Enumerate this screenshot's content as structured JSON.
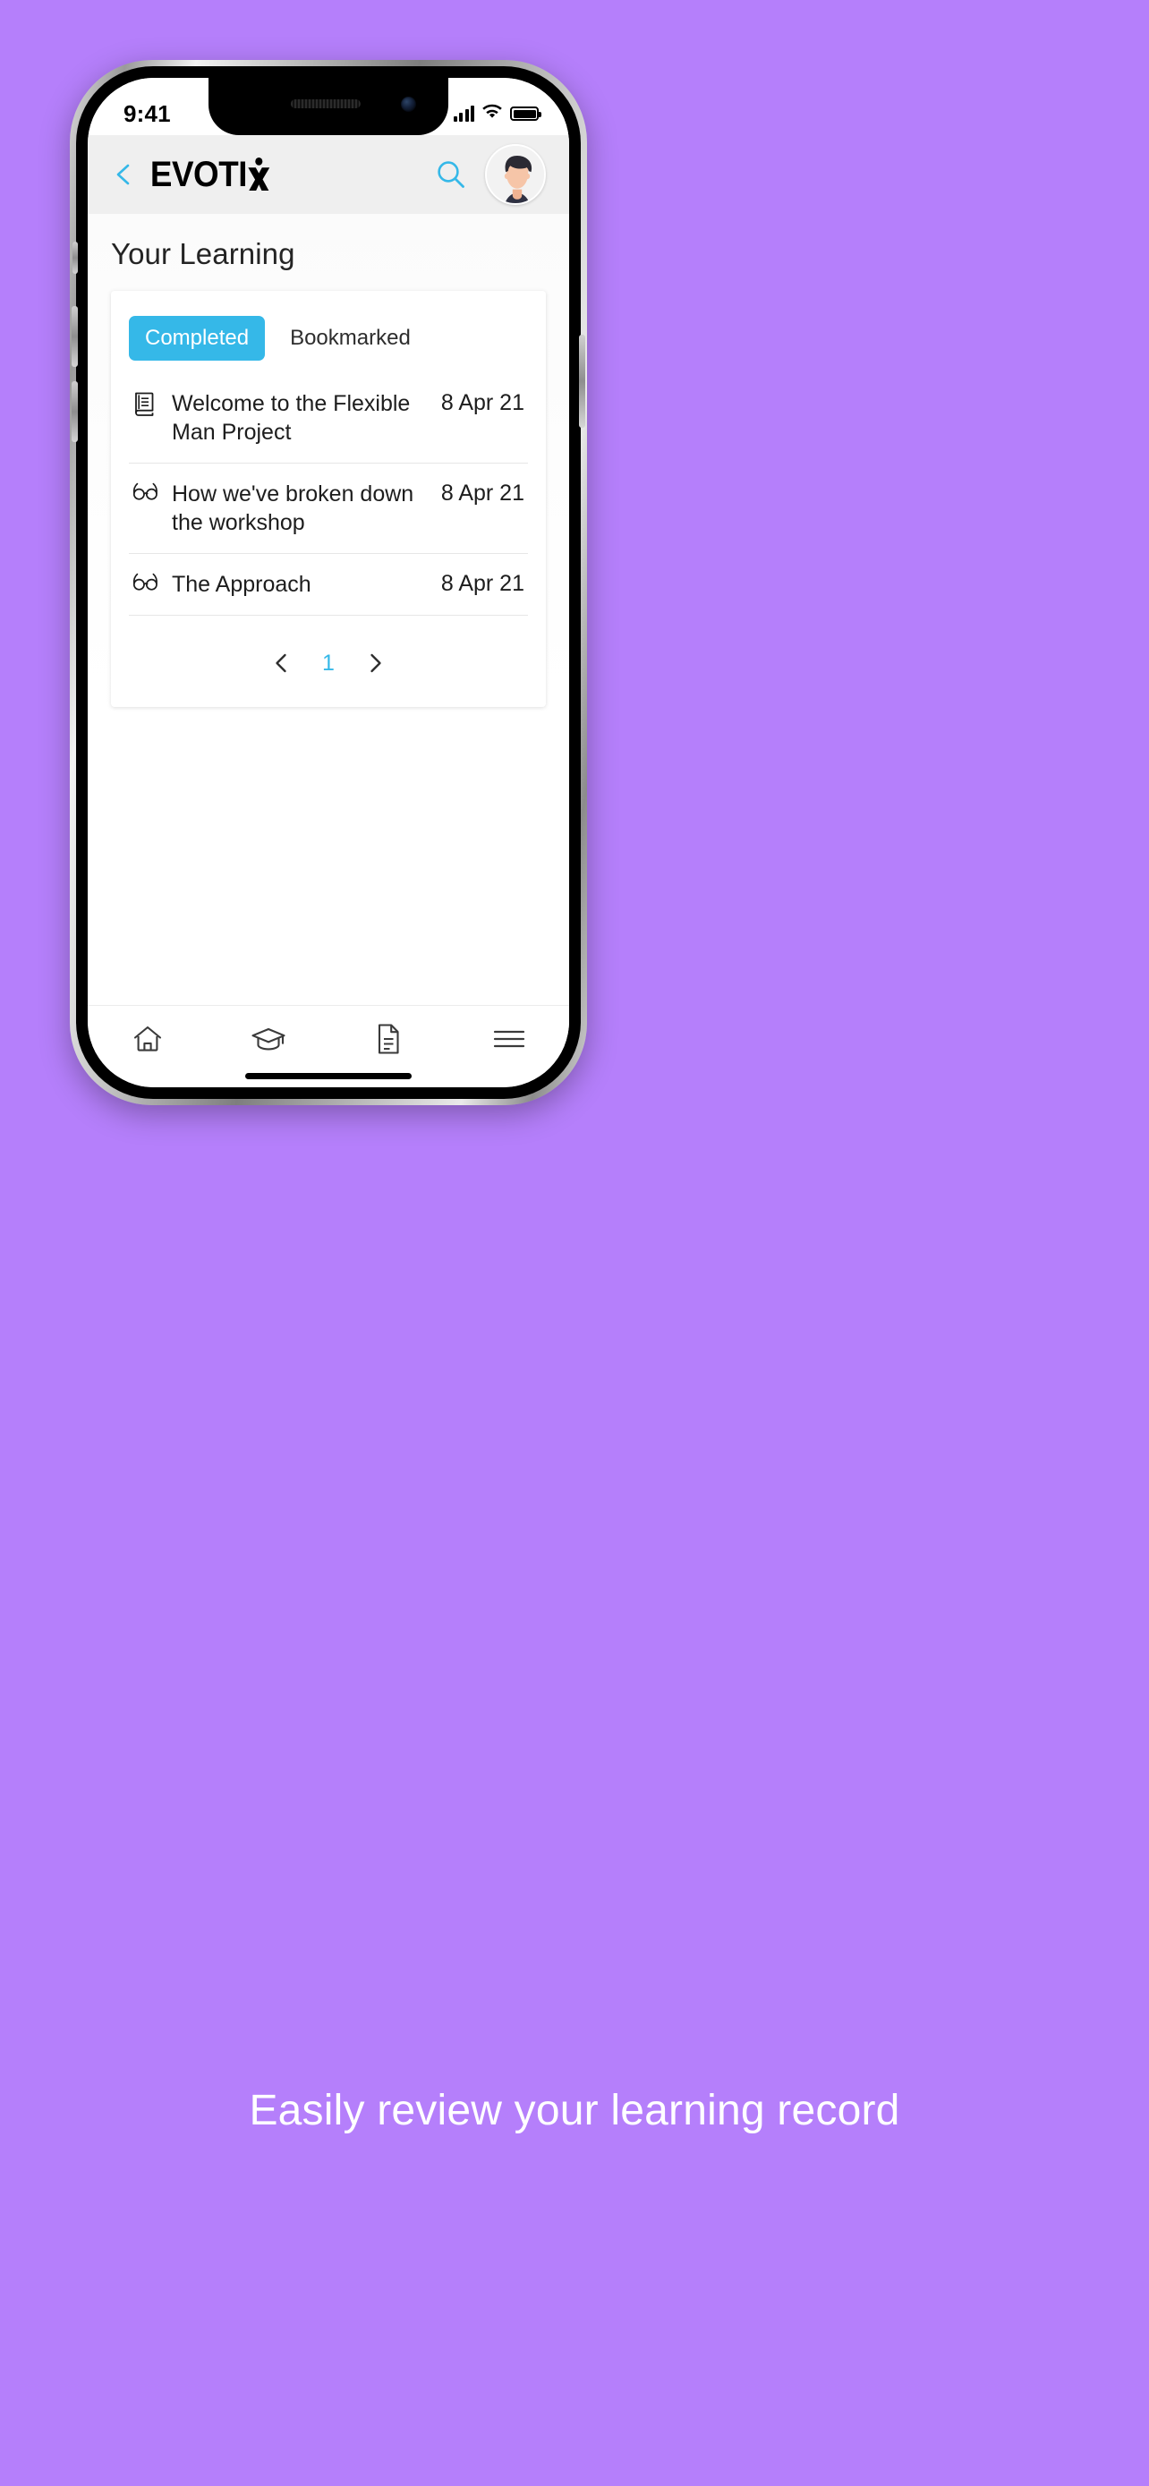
{
  "theme": {
    "background": "#b57ffb",
    "accent": "#35b8e8",
    "header_bg": "#efefef",
    "text": "#1d1d1d"
  },
  "status_bar": {
    "time": "9:41",
    "signal_icon": "cellular-signal-icon",
    "wifi_icon": "wifi-icon",
    "battery_icon": "battery-icon"
  },
  "header": {
    "back_icon": "back-chevron-icon",
    "logo_text": "EVOTI",
    "logo_full": "EVOTIX",
    "search_icon": "search-icon",
    "avatar_icon": "user-avatar"
  },
  "page": {
    "title": "Your Learning"
  },
  "tabs": [
    {
      "label": "Completed",
      "active": true
    },
    {
      "label": "Bookmarked",
      "active": false
    }
  ],
  "list": [
    {
      "icon": "book-icon",
      "title": "Welcome to the Flexible Man Project",
      "date": "8 Apr 21"
    },
    {
      "icon": "glasses-icon",
      "title": "How we've broken down the workshop",
      "date": "8 Apr 21"
    },
    {
      "icon": "glasses-icon",
      "title": "The Approach",
      "date": "8 Apr 21"
    }
  ],
  "pagination": {
    "prev_icon": "chevron-left-icon",
    "page": "1",
    "next_icon": "chevron-right-icon"
  },
  "bottom_nav": [
    {
      "icon": "home-icon",
      "name": "home"
    },
    {
      "icon": "graduation-cap-icon",
      "name": "learning"
    },
    {
      "icon": "document-icon",
      "name": "documents"
    },
    {
      "icon": "hamburger-menu-icon",
      "name": "menu"
    }
  ],
  "caption": {
    "text": "Easily review your learning record"
  }
}
